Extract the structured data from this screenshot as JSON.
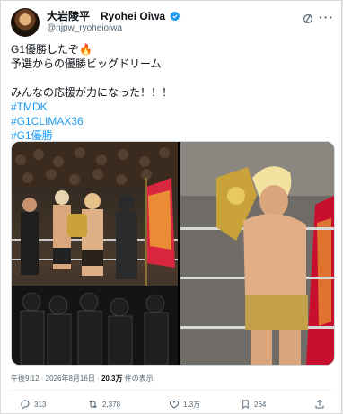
{
  "author": {
    "name_ja": "大岩陵平",
    "name_en": "Ryohei Oiwa",
    "handle": "@njpw_ryoheioiwa"
  },
  "icons": {
    "verified": "verified-badge-icon",
    "grok": "grok-icon",
    "more": "more-icon",
    "reply": "reply-icon",
    "repost": "repost-icon",
    "like": "heart-icon",
    "bookmark": "bookmark-icon",
    "share": "share-icon"
  },
  "post": {
    "line1": "G1優勝したぞ🔥",
    "line2": "予選からの優勝ビッグドリーム",
    "line3": "みんなの応援が力になった！！！",
    "hashtags": [
      "#TMDK",
      "#G1CLIMAX36",
      "#G1優勝"
    ]
  },
  "meta": {
    "time": "午後9:12 · 2026年8月16日 · ",
    "views": "20.3万",
    "views_suffix": " 件の表示"
  },
  "actions": {
    "replies": "313",
    "reposts": "2,378",
    "likes": "1.3万",
    "bookmarks": "264"
  },
  "colors": {
    "link": "#1d9bf0",
    "text": "#0f1419",
    "secondary": "#536471",
    "verified": "#1d9bf0"
  }
}
